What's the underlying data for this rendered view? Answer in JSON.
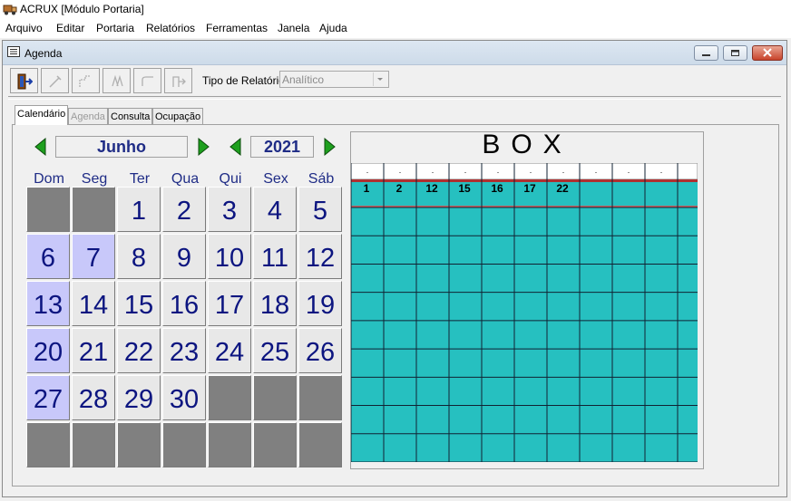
{
  "app": {
    "title": "ACRUX [Módulo Portaria]"
  },
  "menu": [
    "Arquivo",
    "Editar",
    "Portaria",
    "Relatórios",
    "Ferramentas",
    "Janela",
    "Ajuda"
  ],
  "window": {
    "title": "Agenda"
  },
  "toolbar": {
    "icons": [
      "exit-door-icon",
      "edit-icon",
      "move-icon",
      "copy-icon",
      "rotate-icon",
      "transfer-icon"
    ],
    "report_label": "Tipo de Relatório",
    "report_value": "Analítico"
  },
  "tabs": [
    {
      "label": "Calendário",
      "state": "active"
    },
    {
      "label": "Agenda",
      "state": "disabled"
    },
    {
      "label": "Consulta",
      "state": "normal"
    },
    {
      "label": "Ocupação",
      "state": "normal"
    }
  ],
  "calendar": {
    "month": "Junho",
    "year": "2021",
    "weekdays": [
      "Dom",
      "Seg",
      "Ter",
      "Qua",
      "Qui",
      "Sex",
      "Sáb"
    ],
    "weeks": [
      [
        {
          "d": "",
          "s": "gray"
        },
        {
          "d": "",
          "s": "gray"
        },
        {
          "d": "1",
          "s": "light"
        },
        {
          "d": "2",
          "s": "light"
        },
        {
          "d": "3",
          "s": "light"
        },
        {
          "d": "4",
          "s": "light"
        },
        {
          "d": "5",
          "s": "light"
        }
      ],
      [
        {
          "d": "6",
          "s": "blue"
        },
        {
          "d": "7",
          "s": "blue"
        },
        {
          "d": "8",
          "s": "light"
        },
        {
          "d": "9",
          "s": "light"
        },
        {
          "d": "10",
          "s": "light"
        },
        {
          "d": "11",
          "s": "light"
        },
        {
          "d": "12",
          "s": "light"
        }
      ],
      [
        {
          "d": "13",
          "s": "blue"
        },
        {
          "d": "14",
          "s": "light"
        },
        {
          "d": "15",
          "s": "light"
        },
        {
          "d": "16",
          "s": "light"
        },
        {
          "d": "17",
          "s": "light"
        },
        {
          "d": "18",
          "s": "light"
        },
        {
          "d": "19",
          "s": "light"
        }
      ],
      [
        {
          "d": "20",
          "s": "blue"
        },
        {
          "d": "21",
          "s": "light"
        },
        {
          "d": "22",
          "s": "light"
        },
        {
          "d": "23",
          "s": "light"
        },
        {
          "d": "24",
          "s": "light"
        },
        {
          "d": "25",
          "s": "light"
        },
        {
          "d": "26",
          "s": "light"
        }
      ],
      [
        {
          "d": "27",
          "s": "blue"
        },
        {
          "d": "28",
          "s": "light"
        },
        {
          "d": "29",
          "s": "light"
        },
        {
          "d": "30",
          "s": "light"
        },
        {
          "d": "",
          "s": "gray"
        },
        {
          "d": "",
          "s": "gray"
        },
        {
          "d": "",
          "s": "gray"
        }
      ],
      [
        {
          "d": "",
          "s": "gray"
        },
        {
          "d": "",
          "s": "gray"
        },
        {
          "d": "",
          "s": "gray"
        },
        {
          "d": "",
          "s": "gray"
        },
        {
          "d": "",
          "s": "gray"
        },
        {
          "d": "",
          "s": "gray"
        },
        {
          "d": "",
          "s": "gray"
        }
      ]
    ]
  },
  "box": {
    "title": "BOX",
    "header_dots": [
      ".",
      ".",
      ".",
      ".",
      ".",
      ".",
      ".",
      ".",
      ".",
      "."
    ],
    "day_labels": [
      "1",
      "2",
      "12",
      "15",
      "16",
      "17",
      "22",
      "",
      "",
      ""
    ],
    "body_rows": 9,
    "color": "#26c0c0"
  }
}
